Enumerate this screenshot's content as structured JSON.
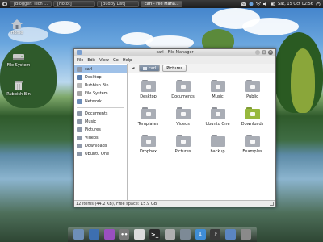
{
  "top_panel": {
    "tasks": [
      {
        "label": "[Blogger: Tech ...",
        "active": false
      },
      {
        "label": "[Hotot]",
        "active": false
      },
      {
        "label": "[Buddy List]",
        "active": false
      },
      {
        "label": "carl - File Mana...",
        "active": true
      }
    ],
    "clock": "Sat, 15 Oct  02:56"
  },
  "desktop_icons": [
    {
      "label": "Home",
      "icon": "home-icon"
    },
    {
      "label": "File System",
      "icon": "drive-icon"
    },
    {
      "label": "Rubbish Bin",
      "icon": "trash-icon"
    }
  ],
  "window": {
    "title": "carl - File Manager",
    "menu": [
      "File",
      "Edit",
      "View",
      "Go",
      "Help"
    ],
    "sidebar": {
      "places": [
        {
          "label": "carl",
          "selected": true
        },
        {
          "label": "Desktop"
        },
        {
          "label": "Rubbish Bin"
        },
        {
          "label": "File System"
        },
        {
          "label": "Network"
        }
      ],
      "bookmarks": [
        {
          "label": "Documents"
        },
        {
          "label": "Music"
        },
        {
          "label": "Pictures"
        },
        {
          "label": "Videos"
        },
        {
          "label": "Downloads"
        },
        {
          "label": "Ubuntu One"
        }
      ]
    },
    "path": {
      "current": "carl",
      "next": "Pictures"
    },
    "files": [
      {
        "label": "Desktop",
        "color": "#a9adb5",
        "emblem": "desktop"
      },
      {
        "label": "Documents",
        "color": "#a9adb5",
        "emblem": "doc"
      },
      {
        "label": "Music",
        "color": "#a9adb5",
        "emblem": "music"
      },
      {
        "label": "Public",
        "color": "#a9adb5",
        "emblem": "public"
      },
      {
        "label": "Templates",
        "color": "#a9adb5",
        "emblem": "template"
      },
      {
        "label": "Videos",
        "color": "#a9adb5",
        "emblem": "video"
      },
      {
        "label": "Ubuntu One",
        "color": "#a9adb5",
        "emblem": "cloud"
      },
      {
        "label": "Downloads",
        "color": "#97b83d",
        "emblem": "download"
      },
      {
        "label": "Dropbox",
        "color": "#a9adb5",
        "emblem": "box"
      },
      {
        "label": "Pictures",
        "color": "#a9adb5",
        "emblem": "picture"
      },
      {
        "label": "backup",
        "color": "#a9adb5",
        "emblem": ""
      },
      {
        "label": "Examples",
        "color": "#a9adb5",
        "emblem": "example"
      }
    ],
    "status": "12 items (44.2 KB), Free space: 15.9 GB"
  },
  "dock": [
    {
      "name": "file-manager-icon",
      "color": "#6e8fb8",
      "glyph": ""
    },
    {
      "name": "browser-icon",
      "color": "#3d6fb0",
      "glyph": ""
    },
    {
      "name": "pidgin-icon",
      "color": "#9a4fc0",
      "glyph": ""
    },
    {
      "name": "hotot-icon",
      "color": "#7a7a7a",
      "glyph": "••"
    },
    {
      "name": "mail-icon",
      "color": "#dcdcdc",
      "glyph": ""
    },
    {
      "name": "terminal-icon",
      "color": "#2a2a2a",
      "glyph": ">_"
    },
    {
      "name": "tools-icon",
      "color": "#b0b0b0",
      "glyph": ""
    },
    {
      "name": "search-icon",
      "color": "#7d8a96",
      "glyph": ""
    },
    {
      "name": "download-icon",
      "color": "#3f8ed6",
      "glyph": "↓"
    },
    {
      "name": "music-icon",
      "color": "#3a3a3a",
      "glyph": "♪"
    },
    {
      "name": "folder-icon",
      "color": "#5b86c2",
      "glyph": ""
    },
    {
      "name": "trash-icon",
      "color": "#8a8a8a",
      "glyph": ""
    }
  ],
  "colors": {
    "selection": "#9fc1e8",
    "folder": "#a9adb5",
    "downloads_folder": "#97b83d"
  }
}
